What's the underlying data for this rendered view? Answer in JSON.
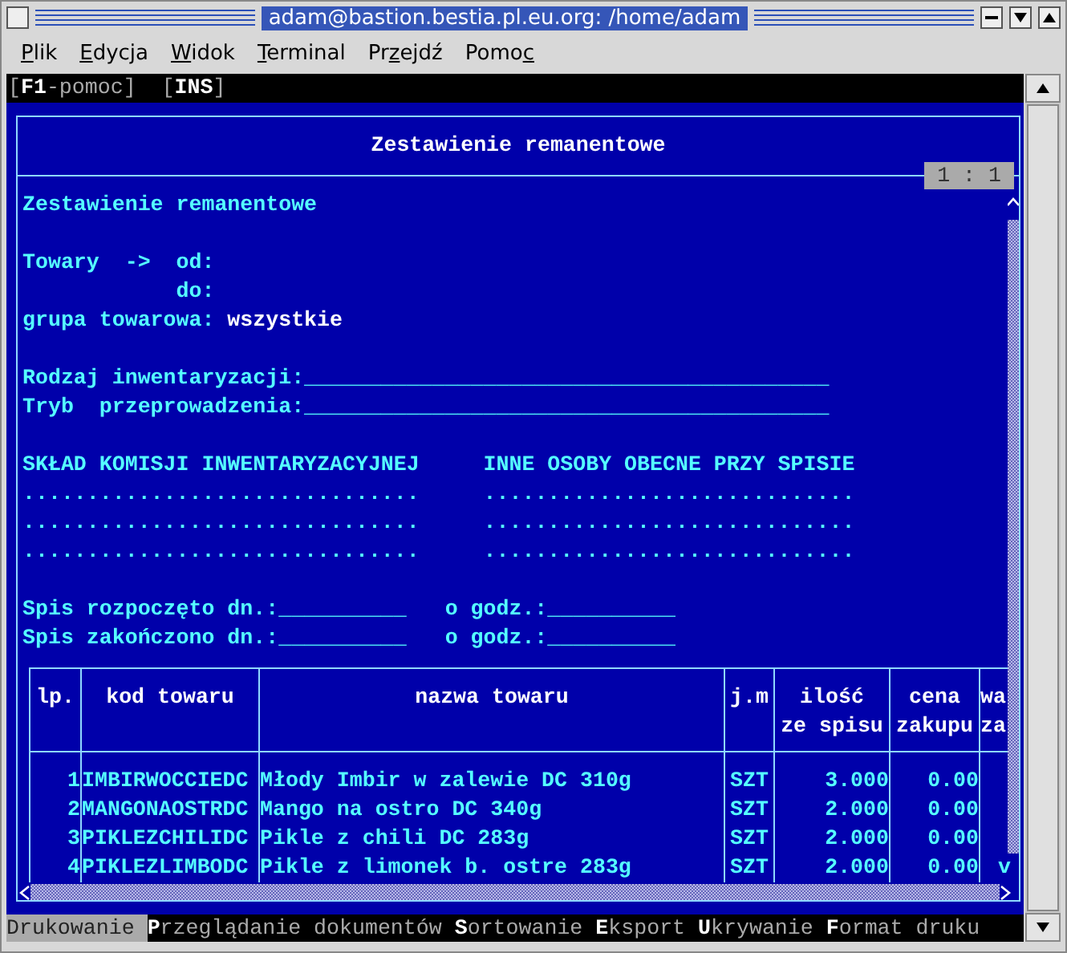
{
  "window": {
    "title": "adam@bastion.bestia.pl.eu.org: /home/adam"
  },
  "menu": [
    {
      "key": "P",
      "after": "lik"
    },
    {
      "key": "E",
      "after": "dycja"
    },
    {
      "key": "W",
      "after": "idok"
    },
    {
      "key": "T",
      "after": "erminal"
    },
    {
      "before": "Pr",
      "key": "z",
      "after": "ejdź"
    },
    {
      "before": "Pomo",
      "key": "c"
    }
  ],
  "hotkeys": [
    {
      "parts": [
        {
          "text": "[",
          "bright": false
        },
        {
          "text": "F1",
          "bright": true
        },
        {
          "text": "-pomoc]",
          "bright": false
        }
      ]
    },
    {
      "parts": [
        {
          "text": "[",
          "bright": false
        },
        {
          "text": "INS",
          "bright": true
        },
        {
          "text": "]",
          "bright": false
        }
      ]
    }
  ],
  "report": {
    "title": "Zestawienie remanentowe",
    "position": "1 : 1",
    "lines": [
      {
        "spaced": false,
        "indent": false,
        "segments": [
          {
            "text": "Zestawienie remanentowe",
            "bright": false
          }
        ]
      },
      {
        "spaced": true,
        "indent": false,
        "segments": [
          {
            "text": "Towary  ->  od:",
            "bright": false
          }
        ]
      },
      {
        "spaced": false,
        "indent": true,
        "segments": [
          {
            "text": "do:",
            "bright": false
          }
        ]
      },
      {
        "spaced": false,
        "indent": false,
        "segments": [
          {
            "text": "grupa towarowa: ",
            "bright": false
          },
          {
            "text": "wszystkie",
            "bright": true
          }
        ]
      },
      {
        "spaced": true,
        "indent": false,
        "segments": [
          {
            "text": "Rodzaj inwentaryzacji:_________________________________________",
            "bright": false
          }
        ]
      },
      {
        "spaced": false,
        "indent": false,
        "segments": [
          {
            "text": "Tryb  przeprowadzenia:_________________________________________",
            "bright": false
          }
        ]
      },
      {
        "spaced": true,
        "indent": false,
        "segments": [
          {
            "text": "SKŁAD KOMISJI INWENTARYZACYJNEJ",
            "bright": false
          },
          {
            "text": "     INNE OSOBY OBECNE PRZY SPISIE",
            "bright": false
          }
        ]
      },
      {
        "spaced": false,
        "indent": false,
        "segments": [
          {
            "text": "...............................",
            "bright": false
          },
          {
            "text": "     .............................",
            "bright": false
          }
        ]
      },
      {
        "spaced": false,
        "indent": false,
        "segments": [
          {
            "text": "...............................",
            "bright": false
          },
          {
            "text": "     .............................",
            "bright": false
          }
        ]
      },
      {
        "spaced": false,
        "indent": false,
        "segments": [
          {
            "text": "...............................",
            "bright": false
          },
          {
            "text": "     .............................",
            "bright": false
          }
        ]
      },
      {
        "spaced": true,
        "indent": false,
        "segments": [
          {
            "text": "Spis rozpoczęto dn.:__________",
            "bright": false
          },
          {
            "text": "   o godz.:__________",
            "bright": false
          }
        ]
      },
      {
        "spaced": false,
        "indent": false,
        "segments": [
          {
            "text": "Spis zakończono dn.:__________",
            "bright": false
          },
          {
            "text": "   o godz.:__________",
            "bright": false
          }
        ]
      }
    ]
  },
  "table": {
    "columns": [
      {
        "lines": [
          "lp."
        ]
      },
      {
        "lines": [
          "kod towaru"
        ]
      },
      {
        "lines": [
          "nazwa towaru"
        ]
      },
      {
        "lines": [
          "j.m"
        ]
      },
      {
        "lines": [
          "ilość",
          "ze spisu"
        ]
      },
      {
        "lines": [
          "cena",
          "zakupu"
        ]
      },
      {
        "lines": [
          "wa",
          "za"
        ]
      }
    ],
    "rows": [
      {
        "cells": [
          "1",
          "IMBIRWOCCIEDC",
          "Młody Imbir w zalewie DC 310g",
          "SZT",
          "3.000",
          "0.00"
        ]
      },
      {
        "cells": [
          "2",
          "MANGONAOSTRDC",
          "Mango na ostro DC 340g",
          "SZT",
          "2.000",
          "0.00"
        ]
      },
      {
        "cells": [
          "3",
          "PIKLEZCHILIDC",
          "Pikle z chili DC 283g",
          "SZT",
          "2.000",
          "0.00"
        ]
      },
      {
        "cells": [
          "4",
          "PIKLEZLIMBODC",
          "Pikle z limonek b. ostre 283g",
          "SZT",
          "2.000",
          "0.00",
          "v"
        ]
      }
    ]
  },
  "actions": [
    {
      "key": "D",
      "label": "rukowanie",
      "selected": true
    },
    {
      "key": "P",
      "label": "rzeglądanie dokumentów",
      "selected": false
    },
    {
      "key": "S",
      "label": "ortowanie",
      "selected": false
    },
    {
      "key": "E",
      "label": "ksport",
      "selected": false
    },
    {
      "key": "U",
      "label": "krywanie",
      "selected": false
    },
    {
      "key": "F",
      "label": "ormat druku",
      "selected": false
    }
  ]
}
